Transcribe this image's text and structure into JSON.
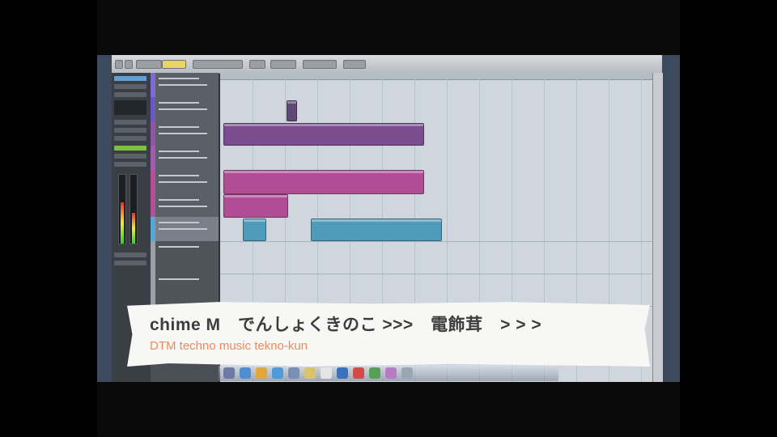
{
  "caption": {
    "title": "chime M　でんしょくきのこ >>>　電飾茸　> > >",
    "subtitle": "DTM  techno music tekno-kun"
  },
  "colors": {
    "purple_part": "#7b4d8f",
    "pink_part": "#b04d95",
    "teal_part": "#4f9ab8",
    "caption_title": "#3d3d3d",
    "caption_subtitle": "#ef8a5c"
  },
  "icons": [
    "cubase-app-icon",
    "finder-icon",
    "safari-icon",
    "chrome-icon",
    "itunes-icon",
    "preview-icon",
    "notes-icon",
    "calendar-icon",
    "trash-icon"
  ]
}
